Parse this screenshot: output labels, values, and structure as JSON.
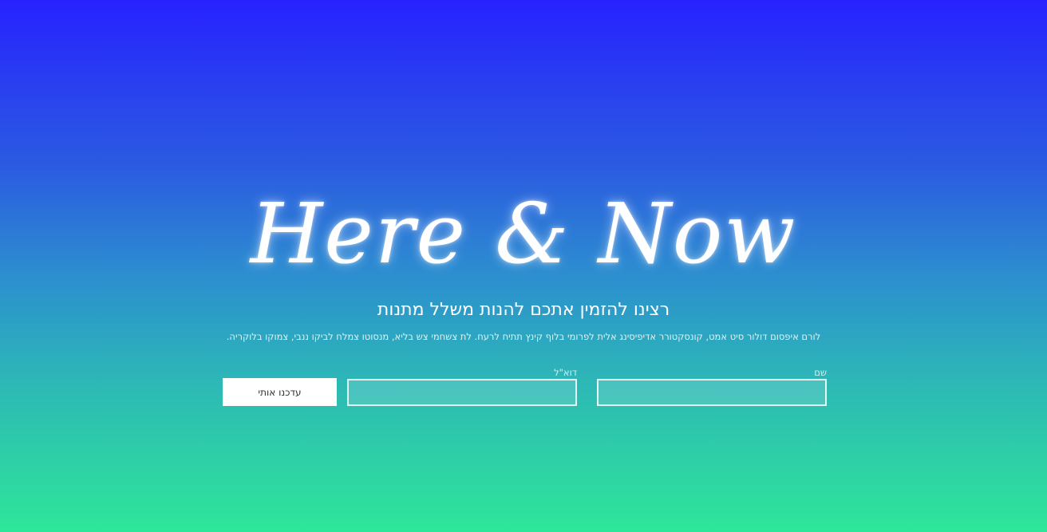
{
  "hero": {
    "title": "Here & Now",
    "subtitle": "רצינו להזמין אתכם להנות משלל מתנות",
    "description": "לורם איפסום דולור סיט אמט, קונסקטורר אדיפיסינג אלית לפרומי בלוף קינץ תתיח לרעח. לת צשחמי צש בליא, מנסוטו צמלח לביקו ננבי, צמוקו בלוקריה."
  },
  "form": {
    "name_label": "שם",
    "name_value": "",
    "email_label": "דוא\"ל",
    "email_value": "",
    "submit_label": "עדכנו אותי"
  },
  "colors": {
    "gradient_top": "#2722ff",
    "gradient_bottom": "#2ee699",
    "button_bg": "#ffffff",
    "text": "#ffffff"
  }
}
